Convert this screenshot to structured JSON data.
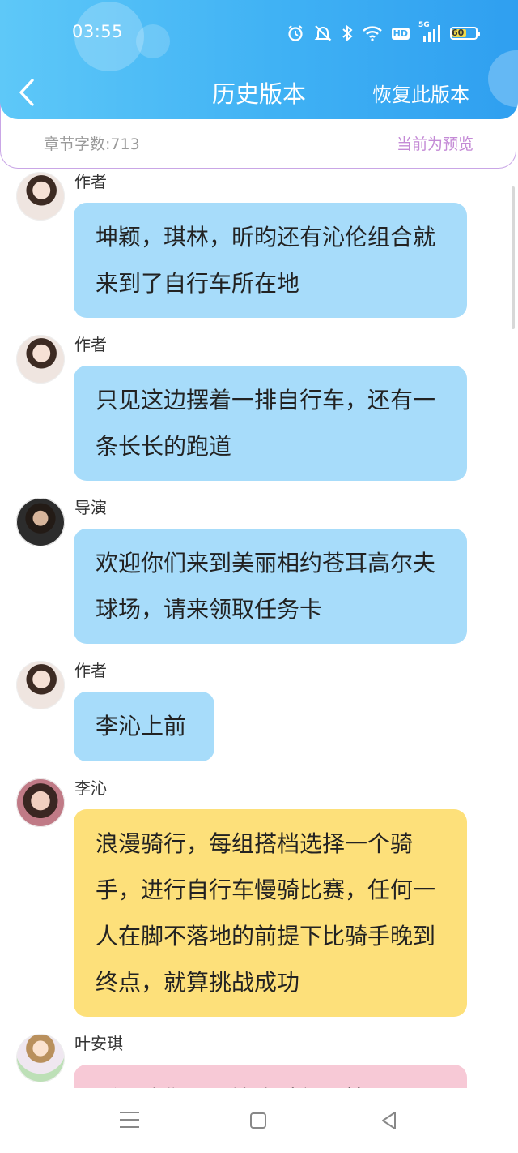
{
  "status_bar": {
    "time": "03:55",
    "battery": "60",
    "network": "5G"
  },
  "header": {
    "title": "历史版本",
    "restore_label": "恢复此版本"
  },
  "info": {
    "word_count": "章节字数:713",
    "preview_label": "当前为预览"
  },
  "messages": [
    {
      "name": "作者",
      "text": "坤颖，琪林，昕昀还有沁伦组合就来到了自行车所在地",
      "color": "#a7dcfa"
    },
    {
      "name": "作者",
      "text": "只见这边摆着一排自行车，还有一条长长的跑道",
      "color": "#a7dcfa"
    },
    {
      "name": "导演",
      "text": "欢迎你们来到美丽相约苍耳高尔夫球场，请来领取任务卡",
      "color": "#a7dcfa"
    },
    {
      "name": "作者",
      "text": "李沁上前",
      "color": "#a7dcfa"
    },
    {
      "name": "李沁",
      "text": "浪漫骑行，每组搭档选择一个骑手，进行自行车慢骑比赛，任何一人在脚不落地的前提下比骑手晚到终点，就算挑战成功",
      "color": "#fde07a"
    },
    {
      "name": "叶安琪",
      "text": "所以我们是要比谁骑得更快一下",
      "color": "#f7c9d6"
    }
  ]
}
